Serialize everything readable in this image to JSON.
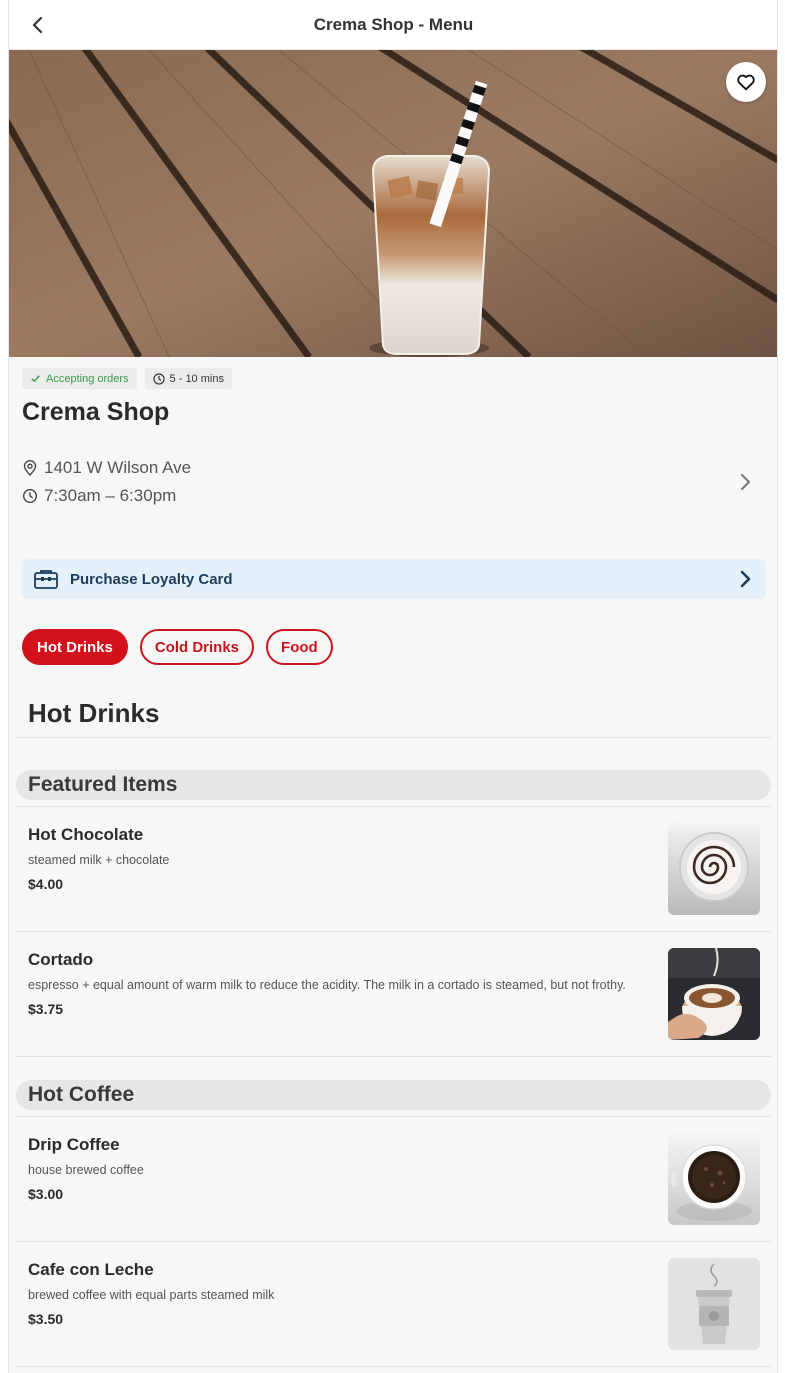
{
  "header": {
    "title": "Crema Shop - Menu"
  },
  "shop": {
    "status": "Accepting orders",
    "wait_time": "5 - 10 mins",
    "name": "Crema Shop",
    "address": "1401 W Wilson Ave",
    "hours": "7:30am – 6:30pm"
  },
  "loyalty": {
    "label": "Purchase Loyalty Card"
  },
  "categories": [
    {
      "label": "Hot Drinks",
      "active": true
    },
    {
      "label": "Cold Drinks",
      "active": false
    },
    {
      "label": "Food",
      "active": false
    }
  ],
  "menu": {
    "section_title": "Hot Drinks",
    "groups": [
      {
        "title": "Featured Items",
        "items": [
          {
            "name": "Hot Chocolate",
            "description": "steamed milk + chocolate",
            "price": "$4.00",
            "image_icon": "hot-chocolate-photo"
          },
          {
            "name": "Cortado",
            "description": "espresso + equal amount of warm milk to reduce the acidity. The milk in a cortado is steamed, but not frothy.",
            "price": "$3.75",
            "image_icon": "cortado-photo"
          }
        ]
      },
      {
        "title": "Hot Coffee",
        "items": [
          {
            "name": "Drip Coffee",
            "description": "house brewed coffee",
            "price": "$3.00",
            "image_icon": "drip-coffee-photo"
          },
          {
            "name": "Cafe con Leche",
            "description": "brewed coffee with equal parts steamed milk",
            "price": "$3.50",
            "image_icon": "to-go-cup-placeholder"
          }
        ]
      }
    ]
  },
  "colors": {
    "brand_red": "#d3111a",
    "status_green": "#3a9a48",
    "loyalty_bg": "#e5f1fa"
  }
}
